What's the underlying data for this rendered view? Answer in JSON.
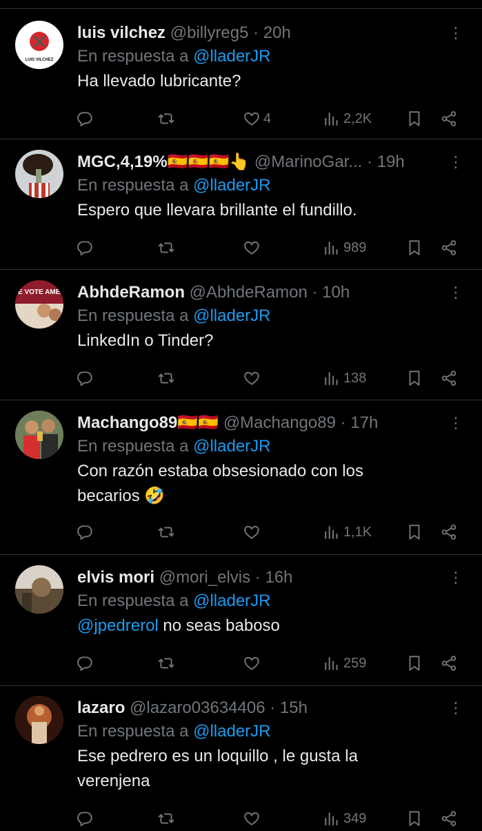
{
  "tweets": [
    {
      "name": "luis vilchez",
      "handle": "@billyreg5",
      "time": "20h",
      "reply_prefix": "En respuesta a",
      "reply_to": "@lladerJR",
      "text": "Ha llevado lubricante?",
      "likes": "4",
      "views": "2,2K",
      "avatar_text": "LUIS VILCHEZ"
    },
    {
      "name": "MGC,4,19%🇪🇸🇪🇸🇪🇸👆",
      "handle": "@MarinoGar...",
      "time": "19h",
      "reply_prefix": "En respuesta a",
      "reply_to": "@lladerJR",
      "text": "Espero  que llevara brillante el fundillo.",
      "likes": "",
      "views": "989"
    },
    {
      "name": "AbhdeRamon",
      "handle": "@AbhdeRamon",
      "time": "10h",
      "reply_prefix": "En respuesta a",
      "reply_to": "@lladerJR",
      "text": "LinkedIn o Tinder?",
      "likes": "",
      "views": "138",
      "avatar_text": "E VOTE AMED VI"
    },
    {
      "name": "Machango89🇪🇸🇪🇸",
      "handle": "@Machango89",
      "time": "17h",
      "reply_prefix": "En respuesta a",
      "reply_to": "@lladerJR",
      "text_line1": "Con razón estaba obsesionado con los",
      "text_line2": "becarios 🤣",
      "likes": "",
      "views": "1,1K"
    },
    {
      "name": "elvis mori",
      "handle": "@mori_elvis",
      "time": "16h",
      "reply_prefix": "En respuesta a",
      "reply_to": "@lladerJR",
      "text_mention": "@jpedrerol",
      "text": " no seas baboso",
      "likes": "",
      "views": "259"
    },
    {
      "name": "lazaro",
      "handle": "@lazaro03634406",
      "time": "15h",
      "reply_prefix": "En respuesta a",
      "reply_to": "@lladerJR",
      "text_line1": "Ese pedrero es un loquillo , le gusta la",
      "text_line2": "verenjena",
      "likes": "",
      "views": "349"
    }
  ],
  "dot": "·",
  "colors": {
    "background": "#000000",
    "text": "#e7e9ea",
    "muted": "#71767b",
    "link": "#1d9bf0",
    "divider": "#2f3336"
  }
}
